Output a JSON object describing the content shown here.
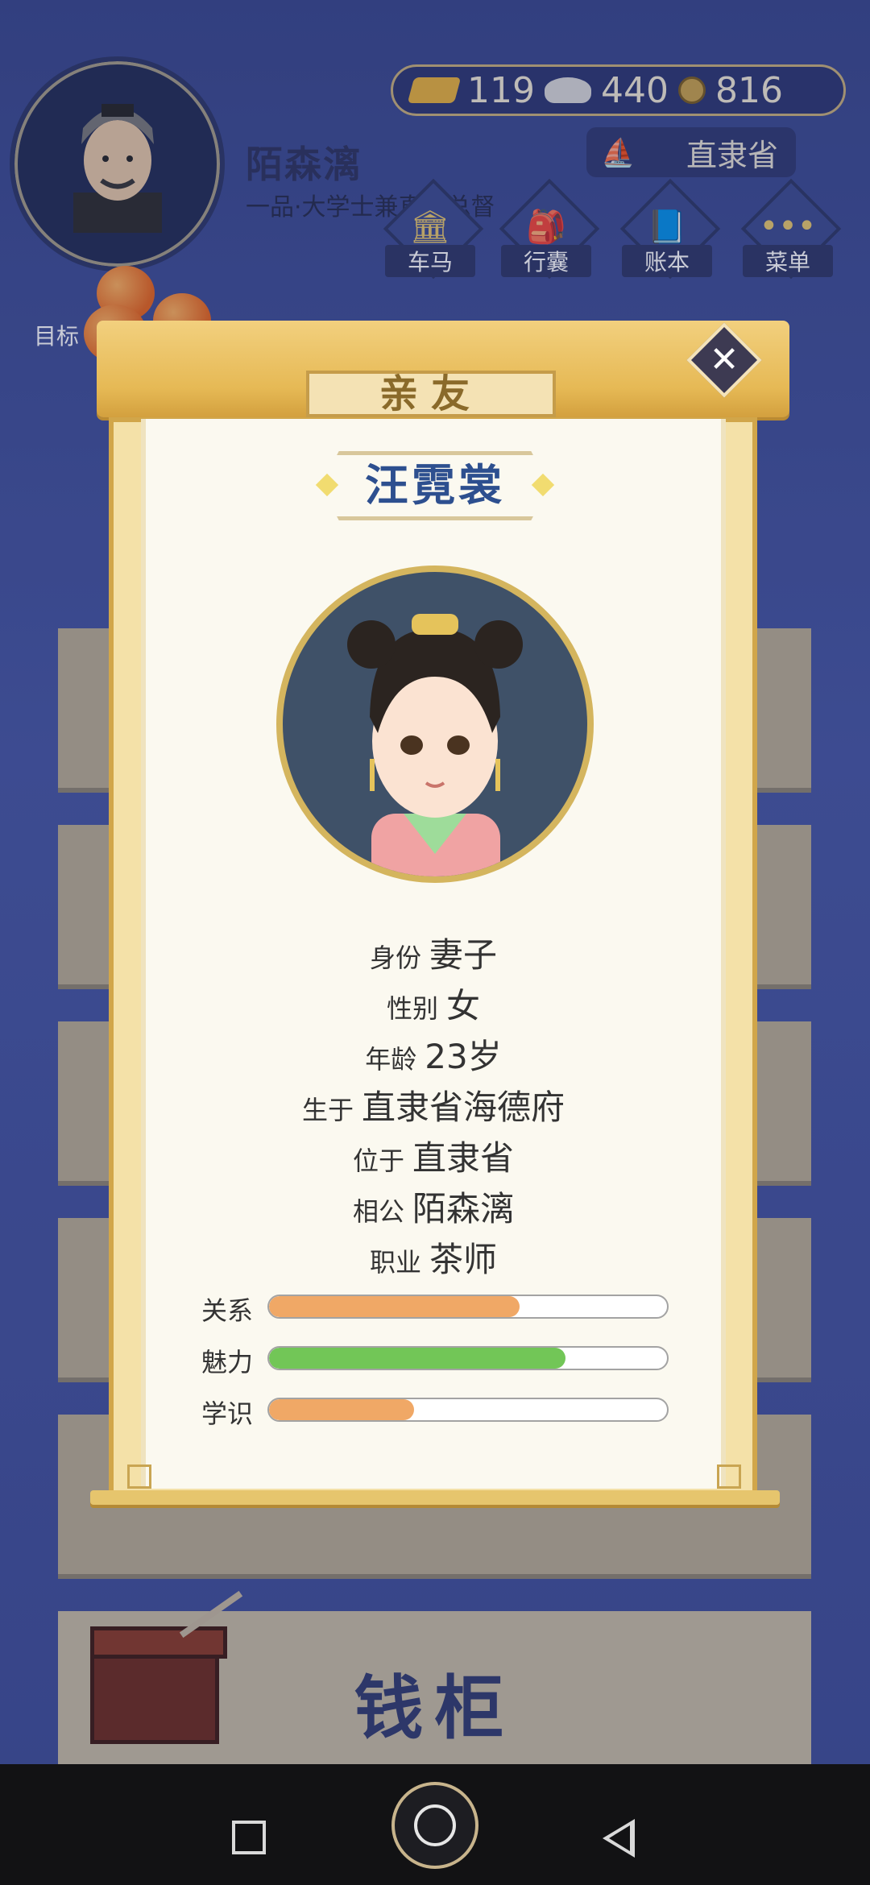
{
  "player": {
    "name": "陌森漓",
    "title": "一品·大学士兼直隶总督"
  },
  "currency": {
    "gold": "119",
    "silver": "440",
    "coins": "816"
  },
  "location": "直隶省",
  "nav": {
    "carriage": "车马",
    "bag": "行囊",
    "ledger": "账本",
    "menu": "菜单"
  },
  "target_label": "目标",
  "modal": {
    "header": "亲友",
    "character_name": "汪霓裳",
    "info": [
      {
        "key": "身份",
        "value": "妻子"
      },
      {
        "key": "性别",
        "value": "女"
      },
      {
        "key": "年龄",
        "value": "23岁"
      },
      {
        "key": "生于",
        "value": "直隶省海德府"
      },
      {
        "key": "位于",
        "value": "直隶省"
      },
      {
        "key": "相公",
        "value": "陌森漓"
      },
      {
        "key": "职业",
        "value": "茶师"
      }
    ],
    "stats": [
      {
        "label": "关系",
        "fraction": 0.63,
        "color": "#f0a866"
      },
      {
        "label": "魅力",
        "fraction": 0.745,
        "color": "#72c657"
      },
      {
        "label": "学识",
        "fraction": 0.365,
        "color": "#f0a866"
      }
    ]
  },
  "money_cabinet": "钱柜",
  "colors": {
    "accent_gold": "#e6b955",
    "name_blue": "#2d4f8f",
    "background": "#3f4f9a"
  },
  "icons": [
    "carriage-icon",
    "bag-icon",
    "ledger-icon",
    "menu-dots-icon",
    "close-icon",
    "gold-ingot-icon",
    "silver-ingot-icon",
    "copper-coin-icon",
    "location-icon"
  ]
}
